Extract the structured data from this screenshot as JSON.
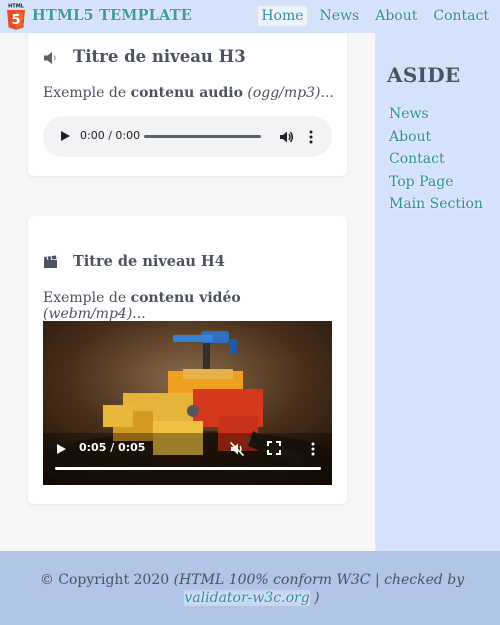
{
  "header": {
    "logo_text": "HTML",
    "logo_number": "5",
    "brand": "HTML5 TEMPLATE",
    "nav": [
      {
        "label": "Home",
        "active": true
      },
      {
        "label": "News",
        "active": false
      },
      {
        "label": "About",
        "active": false
      },
      {
        "label": "Contact",
        "active": false
      }
    ]
  },
  "main": {
    "audio_section": {
      "icon": "speaker-icon",
      "heading": "Titre de niveau H3",
      "desc_prefix": "Exemple de ",
      "desc_bold": "contenu audio",
      "desc_italic": "(ogg/mp3)",
      "desc_suffix": "...",
      "player": {
        "time": "0:00 / 0:00",
        "progress": 0
      }
    },
    "video_section": {
      "icon": "clapperboard-icon",
      "heading": "Titre de niveau H4",
      "desc_prefix": "Exemple de ",
      "desc_bold": "contenu vidéo",
      "desc_italic": "(webm/mp4)",
      "desc_suffix": "...",
      "player": {
        "time": "0:05 / 0:05",
        "progress": 1.0,
        "muted": true
      }
    }
  },
  "aside": {
    "title": "ASIDE",
    "links": [
      "News",
      "About",
      "Contact",
      "Top Page",
      "Main Section"
    ]
  },
  "footer": {
    "copyright": "© Copyright 2020",
    "note_open": "(HTML 100% conform W3C | checked by",
    "link": "validator-w3c.org",
    "note_close": ")"
  },
  "colors": {
    "header_bg": "#d5e2fb",
    "aside_bg": "#d5e2fb",
    "footer_bg": "#b2c5e6",
    "link": "#2d8f9e",
    "logo_orange": "#e44d26"
  }
}
